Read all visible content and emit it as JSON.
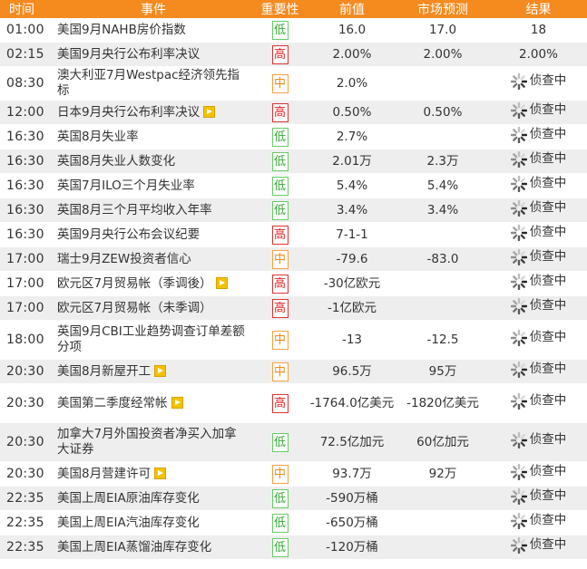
{
  "header": {
    "time": "时间",
    "event": "事件",
    "importance": "重要性",
    "previous": "前值",
    "forecast": "市场预测",
    "result": "结果"
  },
  "rows": [
    {
      "time": "01:00",
      "event": "美国9月NAHB房价指数",
      "importance": "低",
      "level": "low",
      "previous": "16.0",
      "forecast": "17.0",
      "result": "18",
      "pending": false
    },
    {
      "time": "02:15",
      "event": "美国9月央行公布利率决议",
      "importance": "高",
      "level": "high",
      "previous": "2.00%",
      "forecast": "2.00%",
      "result": "2.00%",
      "pending": false
    },
    {
      "time": "08:30",
      "event": "澳大利亚7月Westpac经济领先指标",
      "importance": "中",
      "level": "mid",
      "previous": "2.0%",
      "forecast": "",
      "result": "侦查中",
      "pending": true
    },
    {
      "time": "12:00",
      "event": "日本9月央行公布利率决议",
      "importance": "高",
      "level": "high",
      "previous": "0.50%",
      "forecast": "0.50%",
      "result": "侦查中",
      "pending": true,
      "video": true
    },
    {
      "time": "16:30",
      "event": "英国8月失业率",
      "importance": "低",
      "level": "low",
      "previous": "2.7%",
      "forecast": "",
      "result": "侦查中",
      "pending": true
    },
    {
      "time": "16:30",
      "event": "英国8月失业人数变化",
      "importance": "低",
      "level": "low",
      "previous": "2.01万",
      "forecast": "2.3万",
      "result": "侦查中",
      "pending": true
    },
    {
      "time": "16:30",
      "event": "英国7月ILO三个月失业率",
      "importance": "低",
      "level": "low",
      "previous": "5.4%",
      "forecast": "5.4%",
      "result": "侦查中",
      "pending": true
    },
    {
      "time": "16:30",
      "event": "英国8月三个月平均收入年率",
      "importance": "低",
      "level": "low",
      "previous": "3.4%",
      "forecast": "3.4%",
      "result": "侦查中",
      "pending": true
    },
    {
      "time": "16:30",
      "event": "英国9月央行公布会议纪要",
      "importance": "高",
      "level": "high",
      "previous": "7-1-1",
      "forecast": "",
      "result": "侦查中",
      "pending": true
    },
    {
      "time": "17:00",
      "event": "瑞士9月ZEW投资者信心",
      "importance": "中",
      "level": "mid",
      "previous": "-79.6",
      "forecast": "-83.0",
      "result": "侦查中",
      "pending": true
    },
    {
      "time": "17:00",
      "event": "欧元区7月贸易帐（季调後）",
      "importance": "高",
      "level": "high",
      "previous": "-30亿欧元",
      "forecast": "",
      "result": "侦查中",
      "pending": true,
      "video": true
    },
    {
      "time": "17:00",
      "event": "欧元区7月贸易帐（未季调）",
      "importance": "高",
      "level": "high",
      "previous": "-1亿欧元",
      "forecast": "",
      "result": "侦查中",
      "pending": true
    },
    {
      "time": "18:00",
      "event": "英国9月CBI工业趋势调查订单差额分项",
      "importance": "中",
      "level": "mid",
      "previous": "-13",
      "forecast": "-12.5",
      "result": "侦查中",
      "pending": true
    },
    {
      "time": "20:30",
      "event": "美国8月新屋开工",
      "importance": "中",
      "level": "mid",
      "previous": "96.5万",
      "forecast": "95万",
      "result": "侦查中",
      "pending": true,
      "video": true
    },
    {
      "time": "20:30",
      "event": "美国第二季度经常帐",
      "importance": "高",
      "level": "high",
      "previous": "-1764.0亿美元",
      "forecast": "-1820亿美元",
      "result": "侦查中",
      "pending": true,
      "video": true
    },
    {
      "time": "20:30",
      "event": "加拿大7月外国投资者净买入加拿大证券",
      "importance": "低",
      "level": "low",
      "previous": "72.5亿加元",
      "forecast": "60亿加元",
      "result": "侦查中",
      "pending": true
    },
    {
      "time": "20:30",
      "event": "美国8月营建许可",
      "importance": "中",
      "level": "mid",
      "previous": "93.7万",
      "forecast": "92万",
      "result": "侦查中",
      "pending": true,
      "video": true
    },
    {
      "time": "22:35",
      "event": "美国上周EIA原油库存变化",
      "importance": "低",
      "level": "low",
      "previous": "-590万桶",
      "forecast": "",
      "result": "侦查中",
      "pending": true
    },
    {
      "time": "22:35",
      "event": "美国上周EIA汽油库存变化",
      "importance": "低",
      "level": "low",
      "previous": "-650万桶",
      "forecast": "",
      "result": "侦查中",
      "pending": true
    },
    {
      "time": "22:35",
      "event": "美国上周EIA蒸馏油库存变化",
      "importance": "低",
      "level": "low",
      "previous": "-120万桶",
      "forecast": "",
      "result": "侦查中",
      "pending": true
    }
  ],
  "colors": {
    "header_bg": "#f58a1f",
    "low": "#33aa33",
    "mid": "#f08a1a",
    "high": "#dd2222",
    "row_alt": "#eeeeee"
  },
  "icons": {
    "video": "play-icon",
    "pending": "spinner-icon"
  }
}
